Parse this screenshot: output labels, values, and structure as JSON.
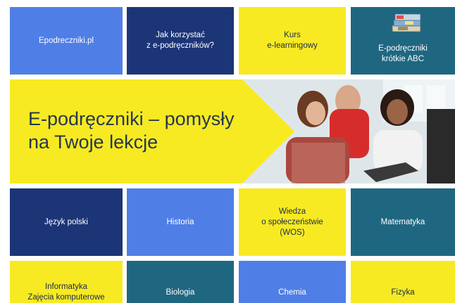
{
  "top_tiles": [
    {
      "label": "Epodreczniki.pl"
    },
    {
      "label": "Jak korzystać\nz e-podręczników?"
    },
    {
      "label": "Kurs\ne-learningowy"
    },
    {
      "label": "E-podręczniki\nkrótkie ABC",
      "icon": "book-stack-icon"
    }
  ],
  "banner": {
    "title": "E-podręczniki – pomysły\nna Twoje lekcje"
  },
  "subject_tiles": [
    {
      "label": "Język polski"
    },
    {
      "label": "Historia"
    },
    {
      "label": "Wiedza\no społeczeństwie\n(WOS)"
    },
    {
      "label": "Matematyka"
    }
  ],
  "bottom_tiles": [
    {
      "label": "Informatyka\nZajęcia komputerowe"
    },
    {
      "label": "Biologia"
    },
    {
      "label": "Chemia"
    },
    {
      "label": "Fizyka"
    }
  ],
  "colors": {
    "blue": "#4f7fe6",
    "navy": "#1b3577",
    "yellow": "#f7ea22",
    "teal": "#1f6780"
  }
}
